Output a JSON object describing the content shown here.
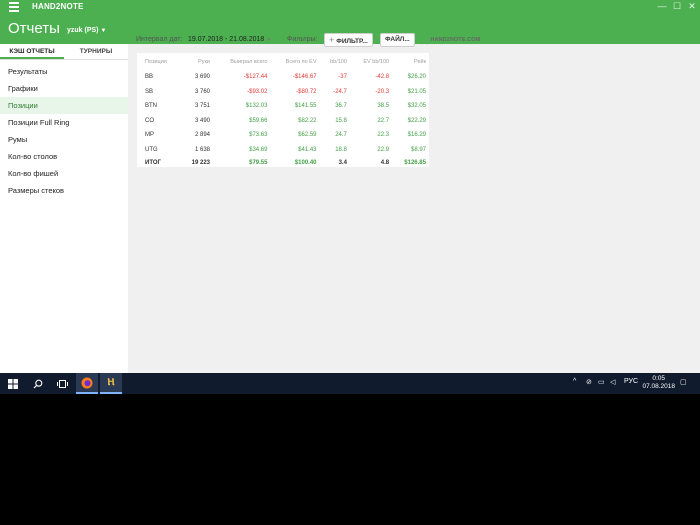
{
  "titlebar": {
    "app_name": "HAND2NOTE",
    "minimize": "—",
    "maximize": "☐",
    "close": "✕"
  },
  "header": {
    "title": "Отчеты",
    "user": "yzuk (PS)"
  },
  "sidebar": {
    "tabs": [
      {
        "label": "КЭШ ОТЧЕТЫ"
      },
      {
        "label": "ТУРНИРЫ"
      }
    ],
    "items": [
      {
        "label": "Результаты"
      },
      {
        "label": "Графики"
      },
      {
        "label": "Позиции"
      },
      {
        "label": "Позиции Full Ring"
      },
      {
        "label": "Румы"
      },
      {
        "label": "Кол-во столов"
      },
      {
        "label": "Кол-во фишей"
      },
      {
        "label": "Размеры стеков"
      }
    ]
  },
  "toolbar": {
    "interval_label": "Интервал дат:",
    "interval_value": "19.07.2018 - 21.08.2018",
    "filters_label": "Фильтры:",
    "filter_button": "ФИЛЬТР...",
    "file_button": "ФАЙЛ...",
    "logo_text": "HAND2NOTE.COM"
  },
  "table": {
    "headers": [
      "Позиция",
      "Руки",
      "Выиграл всего",
      "Всего по EV",
      "bb/100",
      "EV bb/100",
      "Рейк"
    ],
    "rows": [
      [
        "BB",
        "3 690",
        "-$127.44",
        "-$146.67",
        "-37",
        "-42.8",
        "$26.20"
      ],
      [
        "SB",
        "3 760",
        "-$93.02",
        "-$80.72",
        "-24.7",
        "-20.3",
        "$21.05"
      ],
      [
        "BTN",
        "3 751",
        "$132.03",
        "$141.55",
        "36.7",
        "38.5",
        "$32.05"
      ],
      [
        "CO",
        "3 490",
        "$59.66",
        "$82.22",
        "15.8",
        "22.7",
        "$22.29"
      ],
      [
        "MP",
        "2 894",
        "$73.63",
        "$62.59",
        "24.7",
        "22.3",
        "$16.29"
      ],
      [
        "UTG",
        "1 638",
        "$34.69",
        "$41.43",
        "18.8",
        "22.9",
        "$8.97"
      ]
    ],
    "total": [
      "ИТОГ",
      "19 223",
      "$79.55",
      "$100.40",
      "3.4",
      "4.8",
      "$126.85"
    ]
  },
  "taskbar": {
    "language": "РУС",
    "time": "0:05",
    "date": "07.08.2018"
  }
}
